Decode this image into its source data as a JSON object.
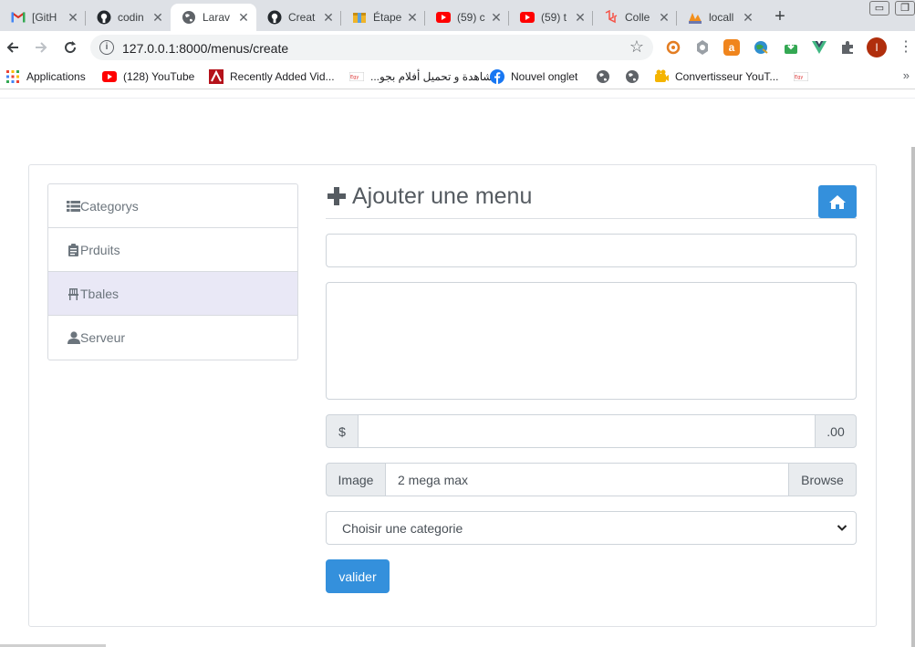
{
  "browser": {
    "tabs": [
      {
        "title": "[GitH",
        "icon": "gmail-icon"
      },
      {
        "title": "codin",
        "icon": "github-icon"
      },
      {
        "title": "Larav",
        "icon": "globe-icon",
        "active": true
      },
      {
        "title": "Creat",
        "icon": "github-icon"
      },
      {
        "title": "Étape",
        "icon": "box-icon"
      },
      {
        "title": "(59) c",
        "icon": "youtube-icon"
      },
      {
        "title": "(59) t",
        "icon": "youtube-icon"
      },
      {
        "title": "Colle",
        "icon": "laravel-icon"
      },
      {
        "title": "locall",
        "icon": "phpmyadmin-icon"
      }
    ],
    "tab_close": "✕",
    "new_tab": "+",
    "url": "127.0.0.1:8000/menus/create",
    "profile_initial": "I",
    "bookmarks": [
      {
        "label": "Applications",
        "icon": "apps-grid-icon"
      },
      {
        "label": "(128) YouTube",
        "icon": "youtube-icon"
      },
      {
        "label": "Recently Added Vid...",
        "icon": "red-logo-icon"
      },
      {
        "label": "",
        "icon": "egybest-icon"
      },
      {
        "label": "مشاهدة و تحميل أفلام بجو...",
        "icon": ""
      },
      {
        "label": "Nouvel onglet",
        "icon": "facebook-icon"
      },
      {
        "label": "",
        "icon": "globe-icon"
      },
      {
        "label": "",
        "icon": "globe-icon"
      },
      {
        "label": "Convertisseur YouT...",
        "icon": "converter-icon"
      },
      {
        "label": "",
        "icon": "egybest-icon"
      }
    ],
    "bookmarks_more": "»"
  },
  "sidebar": {
    "items": [
      {
        "label": "Categorys",
        "icon": "list-icon"
      },
      {
        "label": "Prduits",
        "icon": "clipboard-icon"
      },
      {
        "label": "Tbales",
        "icon": "chair-icon",
        "active": true
      },
      {
        "label": "Serveur",
        "icon": "user-icon"
      }
    ]
  },
  "form": {
    "title": "Ajouter une menu",
    "name_value": "",
    "description_value": "",
    "price_prefix": "$",
    "price_suffix": ".00",
    "price_value": "",
    "image_label": "Image",
    "image_placeholder": "2 mega max",
    "browse_label": "Browse",
    "category_selected": "Choisir une categorie",
    "submit_label": "valider"
  },
  "colors": {
    "primary": "#3490dc",
    "active_item": "#e9e8f6",
    "muted_text": "#6c757d"
  }
}
